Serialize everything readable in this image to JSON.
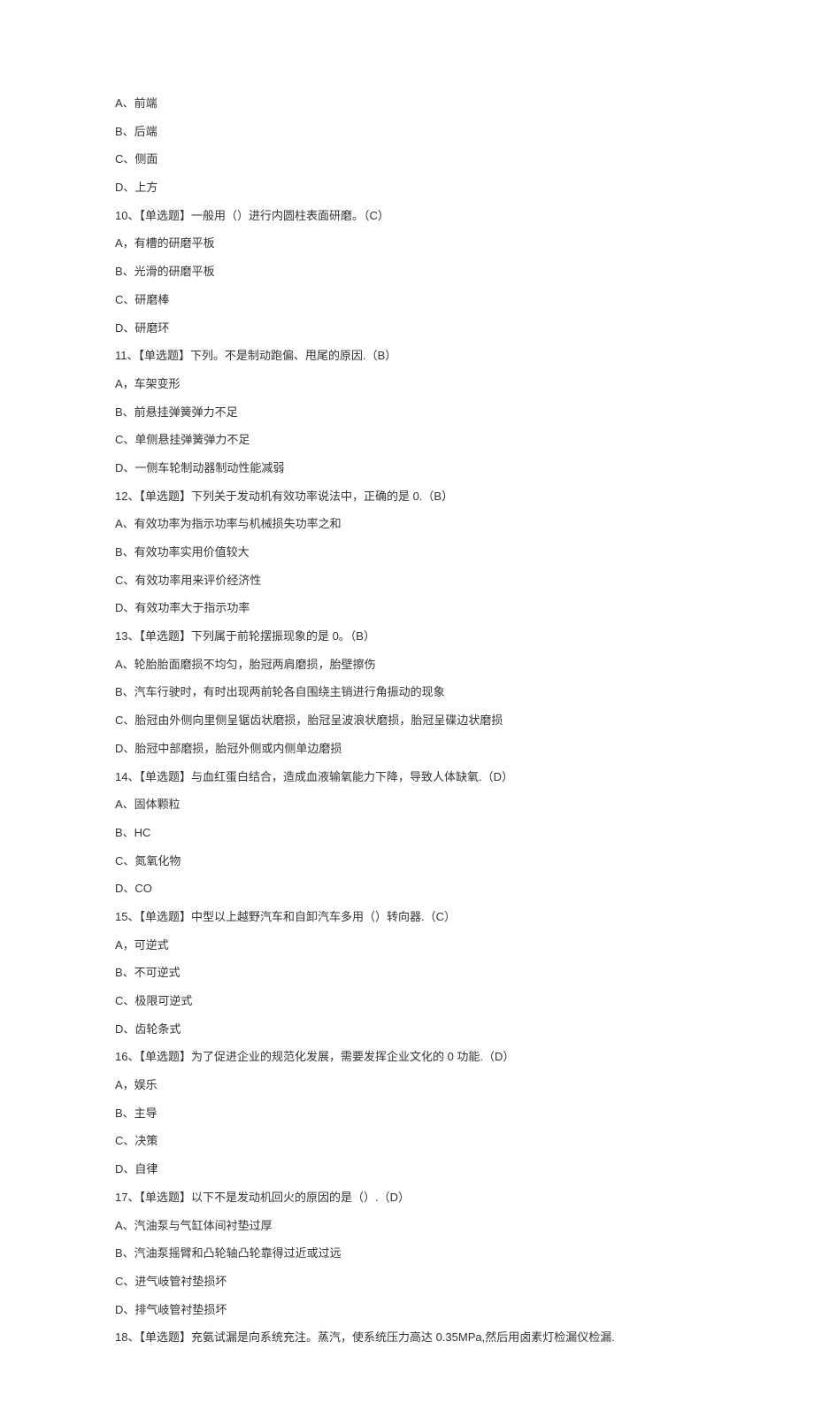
{
  "lines": [
    "A、前端",
    "B、后端",
    "C、侧面",
    "D、上方",
    "10、【单选题】一般用（）进行内圆柱表面研磨。（C）",
    "A，有槽的研磨平板",
    "B、光滑的研磨平板",
    "C、研磨棒",
    "D、研磨环",
    "11、【单选题】下列。不是制动跑偏、甩尾的原因.（B）",
    "A，车架变形",
    "B、前悬挂弹簧弹力不足",
    "C、单侧悬挂弹簧弹力不足",
    "D、一侧车轮制动器制动性能减弱",
    "12、【单选题】下列关于发动机有效功率说法中，正确的是 0.（B）",
    "A、有效功率为指示功率与机械损失功率之和",
    "B、有效功率实用价值较大",
    "C、有效功率用来评价经济性",
    "D、有效功率大于指示功率",
    "13、【单选题】下列属于前轮摆振现象的是 0。（B）",
    "A、轮胎胎面磨损不均匀，胎冠两肩磨损，胎壁擦伤",
    "B、汽车行驶时，有时出现两前轮各自围绕主销进行角振动的现象",
    "C、胎冠由外侧向里侧呈锯齿状磨损，胎冠呈波浪状磨损，胎冠呈碟边状磨损",
    "D、胎冠中部磨损，胎冠外侧或内侧单边磨损",
    "14、【单选题】与血红蛋白结合，造成血液输氧能力下降，导致人体缺氧.（D）",
    "A、固体颗粒",
    "B、HC",
    "C、氮氧化物",
    "D、CO",
    "15、【单选题】中型以上越野汽车和自卸汽车多用（）转向器.（C）",
    "A，可逆式",
    "B、不可逆式",
    "C、极限可逆式",
    "D、齿轮条式",
    "16、【单选题】为了促进企业的规范化发展，需要发挥企业文化的 0 功能.（D）",
    "A，娱乐",
    "B、主导",
    "C、决策",
    "D、自律",
    "17、【单选题】以下不是发动机回火的原因的是（）.（D）",
    "A、汽油泵与气缸体间衬垫过厚",
    "B、汽油泵摇臂和凸轮轴凸轮靠得过近或过远",
    "C、进气岐管衬垫损坏",
    "D、排气岐管衬垫损坏",
    "18、【单选题】充氨试漏是向系统充注。蒸汽，使系统压力高达 0.35MPa,然后用卤素灯检漏仪检漏."
  ]
}
